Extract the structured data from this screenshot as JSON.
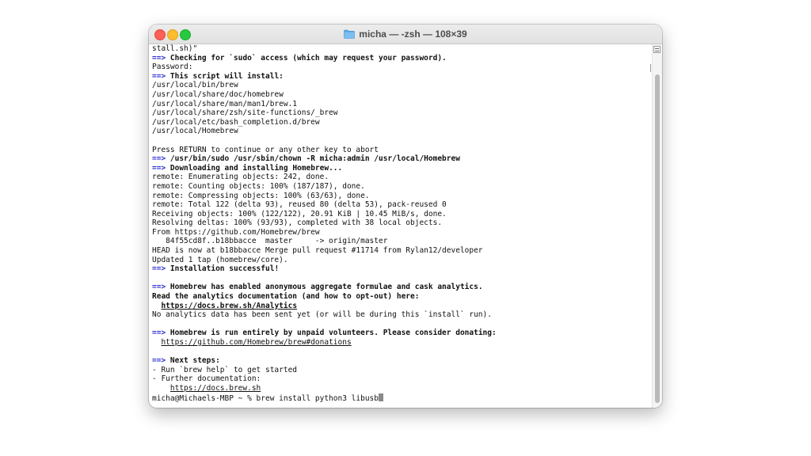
{
  "window": {
    "title": "micha — -zsh — 108×39"
  },
  "terminal": {
    "lines": [
      {
        "parts": [
          {
            "t": "stall.sh)\""
          }
        ]
      },
      {
        "parts": [
          {
            "t": "==>",
            "c": "arrow"
          },
          {
            "t": " Checking for `sudo` access (which may request your password).",
            "c": "bold"
          }
        ]
      },
      {
        "parts": [
          {
            "t": "Password:"
          }
        ]
      },
      {
        "parts": [
          {
            "t": "==>",
            "c": "arrow"
          },
          {
            "t": " This script will install:",
            "c": "bold"
          }
        ]
      },
      {
        "parts": [
          {
            "t": "/usr/local/bin/brew"
          }
        ]
      },
      {
        "parts": [
          {
            "t": "/usr/local/share/doc/homebrew"
          }
        ]
      },
      {
        "parts": [
          {
            "t": "/usr/local/share/man/man1/brew.1"
          }
        ]
      },
      {
        "parts": [
          {
            "t": "/usr/local/share/zsh/site-functions/_brew"
          }
        ]
      },
      {
        "parts": [
          {
            "t": "/usr/local/etc/bash_completion.d/brew"
          }
        ]
      },
      {
        "parts": [
          {
            "t": "/usr/local/Homebrew"
          }
        ]
      },
      {
        "parts": [
          {
            "t": ""
          }
        ]
      },
      {
        "parts": [
          {
            "t": "Press RETURN to continue or any other key to abort"
          }
        ]
      },
      {
        "parts": [
          {
            "t": "==>",
            "c": "arrow"
          },
          {
            "t": " /usr/bin/sudo /usr/sbin/chown -R micha:admin /usr/local/Homebrew",
            "c": "bold"
          }
        ]
      },
      {
        "parts": [
          {
            "t": "==>",
            "c": "arrow"
          },
          {
            "t": " Downloading and installing Homebrew...",
            "c": "bold"
          }
        ]
      },
      {
        "parts": [
          {
            "t": "remote: Enumerating objects: 242, done."
          }
        ]
      },
      {
        "parts": [
          {
            "t": "remote: Counting objects: 100% (187/187), done."
          }
        ]
      },
      {
        "parts": [
          {
            "t": "remote: Compressing objects: 100% (63/63), done."
          }
        ]
      },
      {
        "parts": [
          {
            "t": "remote: Total 122 (delta 93), reused 80 (delta 53), pack-reused 0"
          }
        ]
      },
      {
        "parts": [
          {
            "t": "Receiving objects: 100% (122/122), 20.91 KiB | 10.45 MiB/s, done."
          }
        ]
      },
      {
        "parts": [
          {
            "t": "Resolving deltas: 100% (93/93), completed with 38 local objects."
          }
        ]
      },
      {
        "parts": [
          {
            "t": "From https://github.com/Homebrew/brew"
          }
        ]
      },
      {
        "parts": [
          {
            "t": "   84f55cd8f..b18bbacce  master     -> origin/master"
          }
        ]
      },
      {
        "parts": [
          {
            "t": "HEAD is now at b18bbacce Merge pull request #11714 from Rylan12/developer"
          }
        ]
      },
      {
        "parts": [
          {
            "t": "Updated 1 tap (homebrew/core)."
          }
        ]
      },
      {
        "parts": [
          {
            "t": "==>",
            "c": "arrow"
          },
          {
            "t": " Installation successful!",
            "c": "bold"
          }
        ]
      },
      {
        "parts": [
          {
            "t": ""
          }
        ]
      },
      {
        "parts": [
          {
            "t": "==>",
            "c": "arrow"
          },
          {
            "t": " Homebrew has enabled anonymous aggregate formulae and cask analytics.",
            "c": "bold"
          }
        ]
      },
      {
        "parts": [
          {
            "t": "Read the analytics documentation (and how to opt-out) here:",
            "c": "bold"
          }
        ]
      },
      {
        "parts": [
          {
            "t": "  "
          },
          {
            "t": "https://docs.brew.sh/Analytics",
            "c": "bold link"
          }
        ]
      },
      {
        "parts": [
          {
            "t": "No analytics data has been sent yet (or will be during this `install` run)."
          }
        ]
      },
      {
        "parts": [
          {
            "t": ""
          }
        ]
      },
      {
        "parts": [
          {
            "t": "==>",
            "c": "arrow"
          },
          {
            "t": " Homebrew is run entirely by unpaid volunteers. Please consider donating:",
            "c": "bold"
          }
        ]
      },
      {
        "parts": [
          {
            "t": "  "
          },
          {
            "t": "https://github.com/Homebrew/brew#donations",
            "c": "link"
          }
        ]
      },
      {
        "parts": [
          {
            "t": ""
          }
        ]
      },
      {
        "parts": [
          {
            "t": "==>",
            "c": "arrow"
          },
          {
            "t": " Next steps:",
            "c": "bold"
          }
        ]
      },
      {
        "parts": [
          {
            "t": "- Run `brew help` to get started"
          }
        ]
      },
      {
        "parts": [
          {
            "t": "- Further documentation:"
          }
        ]
      },
      {
        "parts": [
          {
            "t": "    "
          },
          {
            "t": "https://docs.brew.sh",
            "c": "link"
          }
        ]
      },
      {
        "parts": [
          {
            "t": "micha@Michaels-MBP ~ % brew install python3 libusb",
            "cursor": true
          }
        ]
      }
    ]
  },
  "icons": {
    "title_icon": "folder-icon",
    "scroll_menu": "scrollbar-menu-icon"
  },
  "colors": {
    "arrow": "#2e2ed0",
    "close": "#fe5f57",
    "minimize": "#febc2e",
    "maximize": "#28c840"
  }
}
